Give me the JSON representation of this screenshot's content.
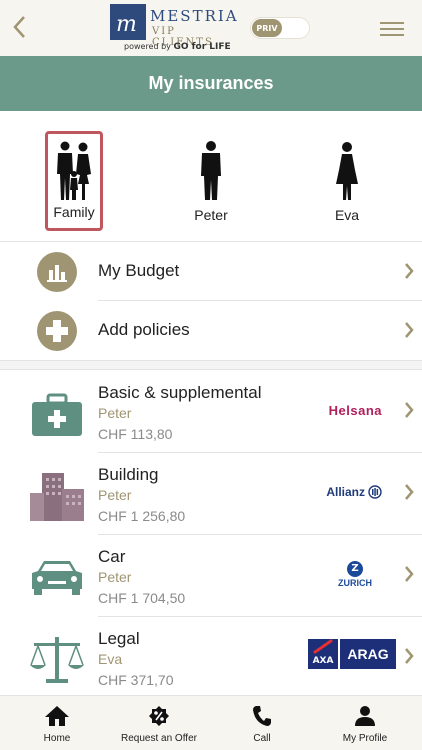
{
  "header": {
    "brand_line1": "MESTRIA",
    "brand_line2": "VIP CLIENTS",
    "powered_prefix": "powered by ",
    "powered_brand": "GO for LIFE",
    "toggle_label": "PRIV"
  },
  "title": "My insurances",
  "persons": [
    {
      "label": "Family",
      "selected": true
    },
    {
      "label": "Peter",
      "selected": false
    },
    {
      "label": "Eva",
      "selected": false
    }
  ],
  "actions": [
    {
      "label": "My Budget",
      "icon": "bar-chart-icon"
    },
    {
      "label": "Add policies",
      "icon": "plus-icon"
    }
  ],
  "policies": [
    {
      "name": "Basic & supplemental",
      "person": "Peter",
      "amount": "CHF 113,80",
      "insurer": "Helsana",
      "icon": "first-aid-kit-icon"
    },
    {
      "name": "Building",
      "person": "Peter",
      "amount": "CHF 1 256,80",
      "insurer": "Allianz",
      "icon": "building-icon"
    },
    {
      "name": "Car",
      "person": "Peter",
      "amount": "CHF 1 704,50",
      "insurer": "ZURICH",
      "icon": "car-icon"
    },
    {
      "name": "Legal",
      "person": "Eva",
      "amount": "CHF 371,70",
      "insurer": "ARAG",
      "insurer_secondary": "AXA",
      "icon": "scales-icon"
    }
  ],
  "bottom_nav": [
    {
      "label": "Home",
      "icon": "home-icon"
    },
    {
      "label": "Request an Offer",
      "icon": "percent-icon"
    },
    {
      "label": "Call",
      "icon": "phone-icon"
    },
    {
      "label": "My Profile",
      "icon": "user-icon"
    }
  ],
  "colors": {
    "header_bg": "#f7f5ef",
    "title_bar": "#6b9a8b",
    "accent_gold": "#a09572",
    "selected_border": "#c0565e",
    "icon_teal": "#5f8f80",
    "building_mauve": "#8a6f7f"
  }
}
